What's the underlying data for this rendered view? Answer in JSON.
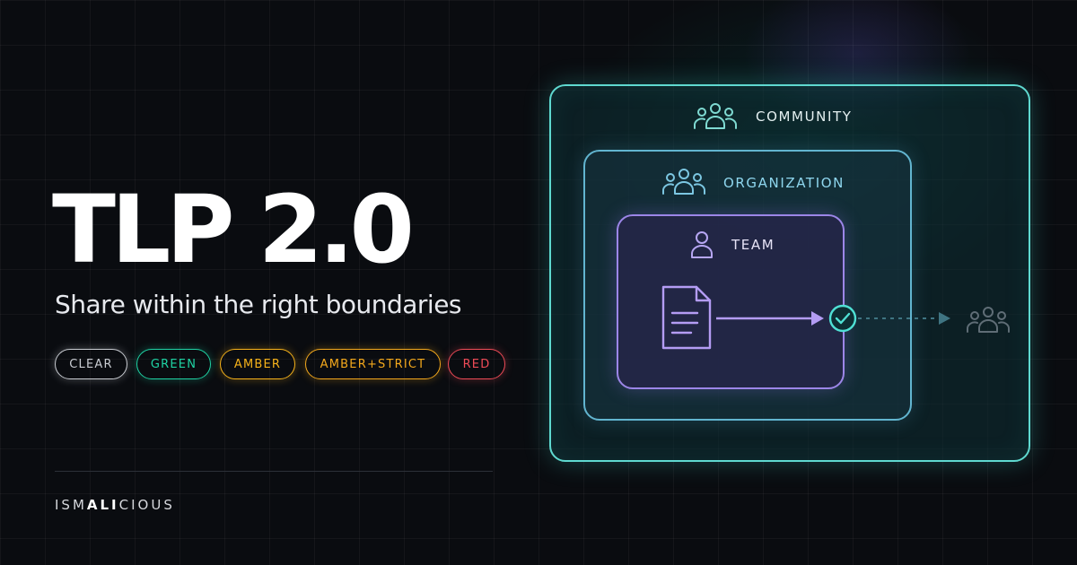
{
  "headline": "TLP 2.0",
  "subtitle": "Share within the right boundaries",
  "tlp_levels": [
    {
      "label": "CLEAR",
      "color": "#c9ccd2"
    },
    {
      "label": "GREEN",
      "color": "#1fd3a4"
    },
    {
      "label": "AMBER",
      "color": "#f6b21a"
    },
    {
      "label": "AMBER+STRICT",
      "color": "#f3a81c"
    },
    {
      "label": "RED",
      "color": "#ef4b57"
    }
  ],
  "diagram": {
    "community": {
      "label": "COMMUNITY",
      "icon": "group-icon",
      "color": "#5fd9d0"
    },
    "organization": {
      "label": "ORGANIZATION",
      "icon": "group-icon",
      "color": "#62b5d0"
    },
    "team": {
      "label": "TEAM",
      "icon": "person-icon",
      "color": "#9c86e8"
    },
    "document_icon": "document-icon",
    "check_icon": "check-circle-icon",
    "outside_icon": "group-icon"
  },
  "brand": {
    "prefix": "ISM",
    "highlight": "ALI",
    "suffix": "CIOUS"
  }
}
